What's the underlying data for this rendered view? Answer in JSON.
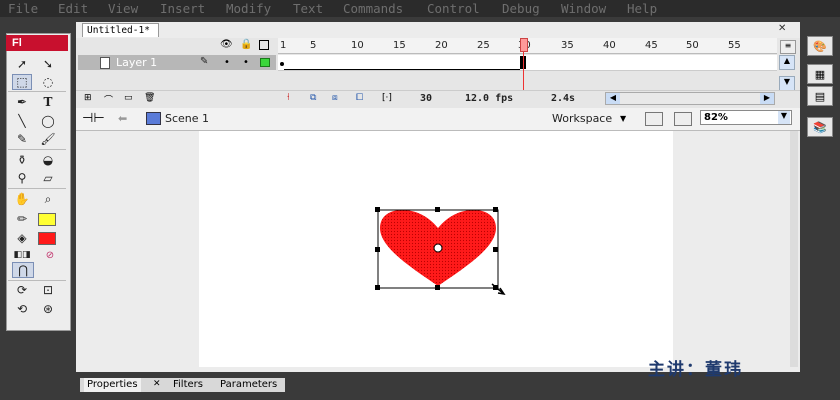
{
  "menu": {
    "items": [
      "File",
      "Edit",
      "View",
      "Insert",
      "Modify",
      "Text",
      "Commands",
      "Control",
      "Debug",
      "Window",
      "Help"
    ]
  },
  "app": {
    "logo": "Fl"
  },
  "document": {
    "tab_title": "Untitled-1*"
  },
  "timeline": {
    "frame_numbers": [
      "1",
      "5",
      "10",
      "15",
      "20",
      "25",
      "30",
      "35",
      "40",
      "45",
      "50",
      "55"
    ],
    "layer_name": "Layer 1",
    "current_frame": "30",
    "frame_rate": "12.0 fps",
    "elapsed": "2.4s"
  },
  "editbar": {
    "scene": "Scene 1",
    "workspace": "Workspace",
    "zoom": "82%"
  },
  "panels": {
    "tabs": [
      "Properties",
      "Filters",
      "Parameters"
    ]
  },
  "colors": {
    "fill": "#ff1a1a",
    "stroke": "#000000",
    "brand": "#c8102e",
    "fill_swatch_tool": "#ffff33",
    "watermark": "#1f3a6e"
  },
  "watermark": "主讲：董玮"
}
